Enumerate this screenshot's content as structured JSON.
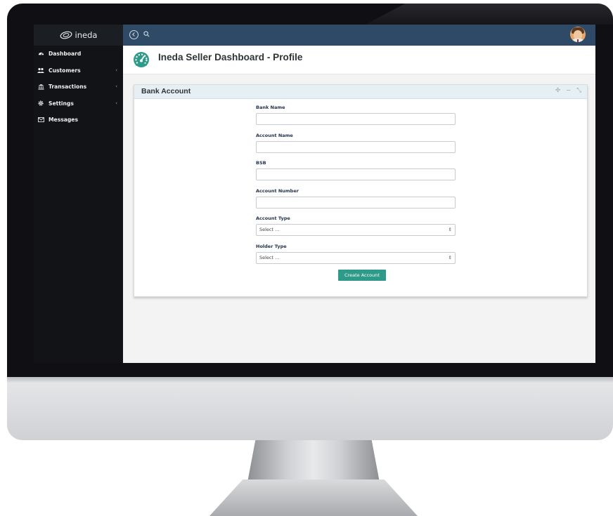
{
  "brand": {
    "name": "ineda"
  },
  "sidebar": {
    "items": [
      {
        "label": "Dashboard",
        "icon": "dashboard-icon",
        "has_chevron": false
      },
      {
        "label": "Customers",
        "icon": "users-icon",
        "has_chevron": true
      },
      {
        "label": "Transactions",
        "icon": "bank-icon",
        "has_chevron": true
      },
      {
        "label": "Settings",
        "icon": "gear-icon",
        "has_chevron": true
      },
      {
        "label": "Messages",
        "icon": "envelope-icon",
        "has_chevron": false
      }
    ],
    "chevron": "‹"
  },
  "topbar": {
    "icons": [
      "back-icon",
      "search-icon",
      "avatar"
    ],
    "color": "#2e4a66"
  },
  "header": {
    "title": "Ineda Seller Dashboard - Profile"
  },
  "panel": {
    "title": "Bank Account",
    "tools": [
      "✣",
      "−",
      "⤡"
    ],
    "fields": {
      "bank_name": {
        "label": "Bank Name",
        "value": ""
      },
      "account_name": {
        "label": "Account Name",
        "value": ""
      },
      "bsb": {
        "label": "BSB",
        "value": ""
      },
      "account_number": {
        "label": "Account Number",
        "value": ""
      },
      "account_type": {
        "label": "Account Type",
        "value": "Select ..."
      },
      "holder_type": {
        "label": "Holder Type",
        "value": "Select ..."
      }
    },
    "select_arrows": "⇕",
    "submit_label": "Create Account"
  },
  "colors": {
    "accent": "#2e9a89",
    "sidebar": "#111316",
    "topbar": "#2e4a66"
  }
}
